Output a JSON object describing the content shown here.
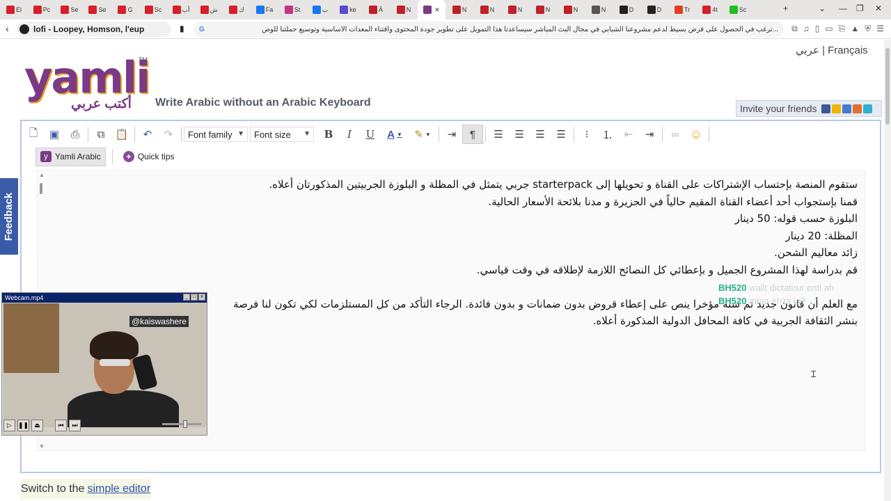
{
  "browser": {
    "tabs": [
      {
        "label": "El",
        "color": "#d4202a"
      },
      {
        "label": "Pc",
        "color": "#d4202a"
      },
      {
        "label": "Se",
        "color": "#d4202a"
      },
      {
        "label": "Se",
        "color": "#d4202a"
      },
      {
        "label": "G",
        "color": "#d4202a"
      },
      {
        "label": "Sc",
        "color": "#d4202a"
      },
      {
        "label": "أب",
        "color": "#d4202a"
      },
      {
        "label": "ش",
        "color": "#d4202a"
      },
      {
        "label": "ك",
        "color": "#d4202a"
      },
      {
        "label": "Fa",
        "color": "#1877f2"
      },
      {
        "label": "St",
        "color": "#c13584"
      },
      {
        "label": "ب",
        "color": "#1877f2"
      },
      {
        "label": "ke",
        "color": "#5a4ad0"
      },
      {
        "label": "Â",
        "color": "#c0202a"
      },
      {
        "label": "N",
        "color": "#c0202a"
      },
      {
        "label": "",
        "color": "#7a3a86"
      },
      {
        "label": "N",
        "color": "#c0202a"
      },
      {
        "label": "N",
        "color": "#c0202a"
      },
      {
        "label": "N",
        "color": "#c0202a"
      },
      {
        "label": "N",
        "color": "#c0202a"
      },
      {
        "label": "N",
        "color": "#c0202a"
      },
      {
        "label": "N",
        "color": "#555555"
      },
      {
        "label": "D",
        "color": "#222222"
      },
      {
        "label": "D",
        "color": "#222222"
      },
      {
        "label": "Tr",
        "color": "#e04020"
      },
      {
        "label": "4t",
        "color": "#d4202a"
      },
      {
        "label": "Sc",
        "color": "#20c020"
      }
    ],
    "active_tab_index": 15,
    "new_tab": "+",
    "media_title": "lofi - Loopey, Homson, l'eup",
    "url": "...ترغب في الحصول على قرض بسيط لدعم مشروعنا الشبابي في مجال البث المباشر سيساعدنا هذا التمويل على تطوير جودة المحتوى واقتناء المعدات الأساسية وتوسيع حملتنا للوص"
  },
  "page": {
    "lang_links": "عربي |  Français",
    "logo_word": "yamli",
    "logo_arabic": "أكتب عربي",
    "logo_tm": "TM",
    "tagline": "Write Arabic without an Arabic Keyboard",
    "invite": "Invite your friends",
    "feedback": "Feedback",
    "switch_prefix": "Switch to the",
    "switch_link": "simple editor"
  },
  "toolbar": {
    "font_family": "Font family",
    "font_size": "Font size",
    "bold": "B",
    "italic": "I",
    "underline": "U",
    "text_color": "A",
    "yamli_arabic": "Yamli Arabic",
    "quick_tips": "Quick tips"
  },
  "editor": {
    "lines": [
      "ستقوم المنصة بإحتساب الإشتراكات على القناة و تحويلها إلى starterpack جربي يتمثل في المظلة و البلوزة الجربيتين المذكورتان أعلاه.",
      "قمنا بإستجواب أحد أعضاء القناة المقيم حالياً في الجزيرة و مدنا بلائحة الأسعار الحالية.",
      "البلوزة حسب قوله: 50 دينار",
      "المظلة: 20 دينار",
      "زائد معاليم الشحن.",
      "قم بدراسة لهذا المشروع الجميل و بإعطائي كل النصائح اللازمة لإطلاقه في وقت قياسي."
    ],
    "para2": [
      "مع العلم أن قانون جديد تم سنه مؤخرا ينص على إعطاء قروض بدون ضمانات و بدون فائدة. الرجاء التأكد من كل المستلزمات لكي تكون لنا فرصة",
      "بنشر الثقافة الجربية في كافة المحافل الدولية المذكورة أعلاه."
    ]
  },
  "chat": [
    {
      "user": "BH520",
      "message": "wallt dictatour enti ah"
    },
    {
      "user": "BH520",
      "message": "mtaa eh'ta ia?"
    }
  ],
  "webcam": {
    "title": "Webcam.mp4",
    "handle": "@kaiswashere"
  }
}
